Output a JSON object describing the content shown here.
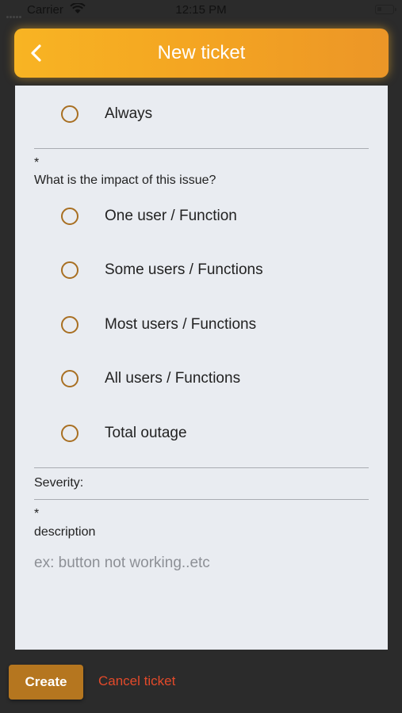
{
  "status_bar": {
    "carrier": "Carrier",
    "time": "12:15 PM"
  },
  "header": {
    "title": "New ticket",
    "back_icon": "chevron-left-icon",
    "gradient": [
      "#f8b423",
      "#ec9627"
    ]
  },
  "frequency": {
    "options": [
      {
        "label": "Always"
      }
    ]
  },
  "impact": {
    "required_mark": "*",
    "question": "What is the impact of this issue?",
    "options": [
      {
        "label": "One user / Function"
      },
      {
        "label": "Some users / Functions"
      },
      {
        "label": "Most users / Functions"
      },
      {
        "label": "All users / Functions"
      },
      {
        "label": "Total outage"
      }
    ]
  },
  "severity": {
    "label": "Severity:"
  },
  "description": {
    "required_mark": "*",
    "label": "description",
    "placeholder": "ex: button not working..etc",
    "value": ""
  },
  "footer": {
    "create_label": "Create",
    "cancel_label": "Cancel ticket"
  },
  "colors": {
    "background": "#2b2b2b",
    "card": "#e9ecf1",
    "radio_ring": "#a86f22",
    "create_button": "#b5761f",
    "cancel_text": "#e34a2a"
  }
}
